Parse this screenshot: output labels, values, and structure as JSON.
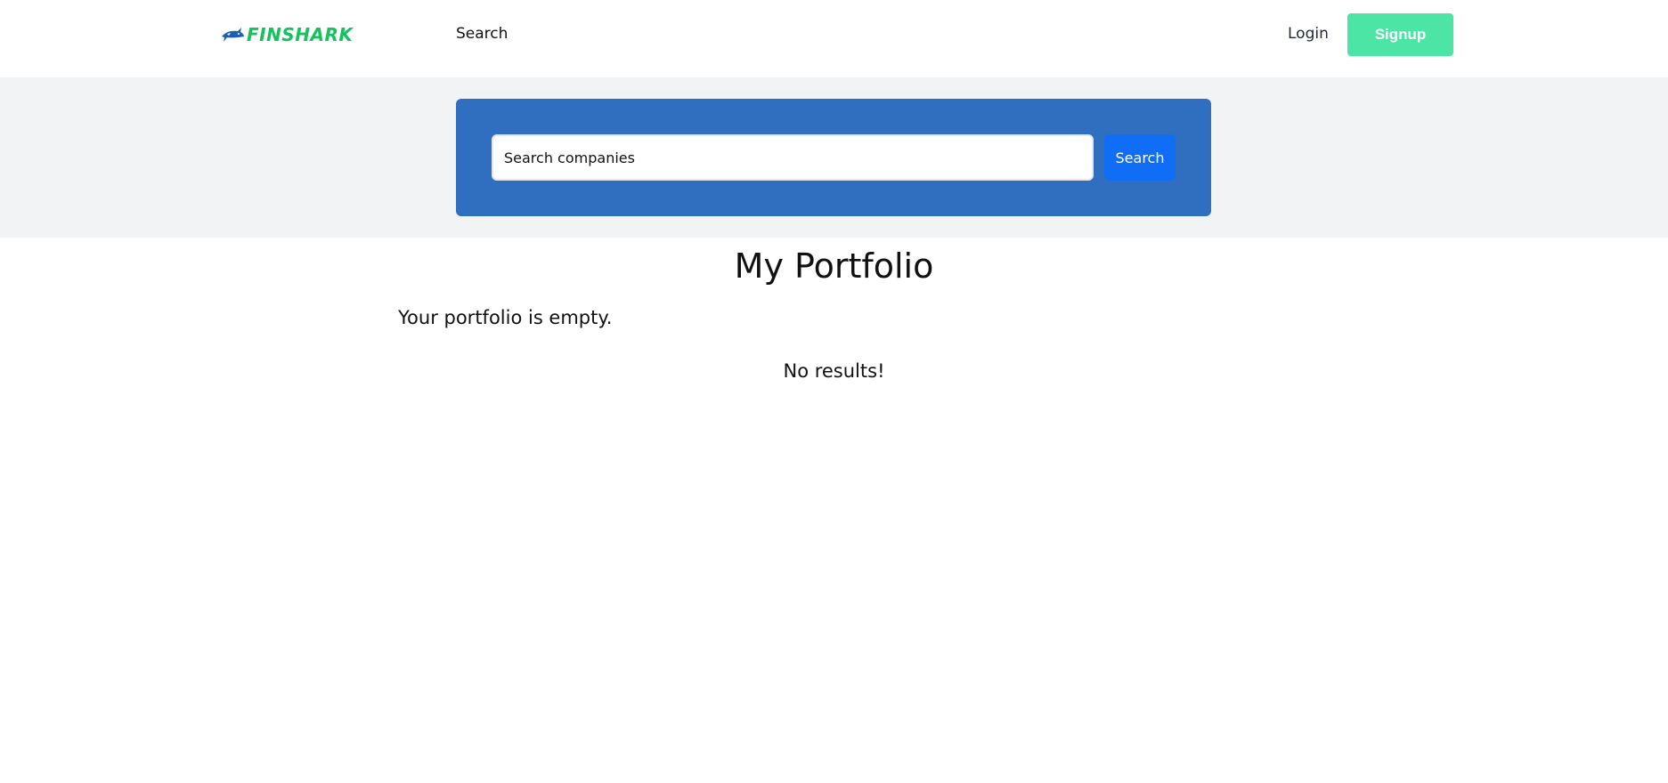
{
  "navbar": {
    "logo_text": "FINSHARK",
    "search_link": "Search",
    "login_link": "Login",
    "signup_button": "Signup"
  },
  "search": {
    "placeholder": "Search companies",
    "button_label": "Search"
  },
  "portfolio": {
    "title": "My Portfolio",
    "empty_message": "Your portfolio is empty."
  },
  "results": {
    "empty_message": "No results!"
  },
  "colors": {
    "brand_green": "#16c25f",
    "signup_bg": "#4de5a6",
    "search_panel_bg": "#306fbf",
    "search_button_bg": "#0f6ef5",
    "band_bg": "#f2f3f5"
  },
  "icons": {
    "logo": "shark-logo-icon"
  }
}
